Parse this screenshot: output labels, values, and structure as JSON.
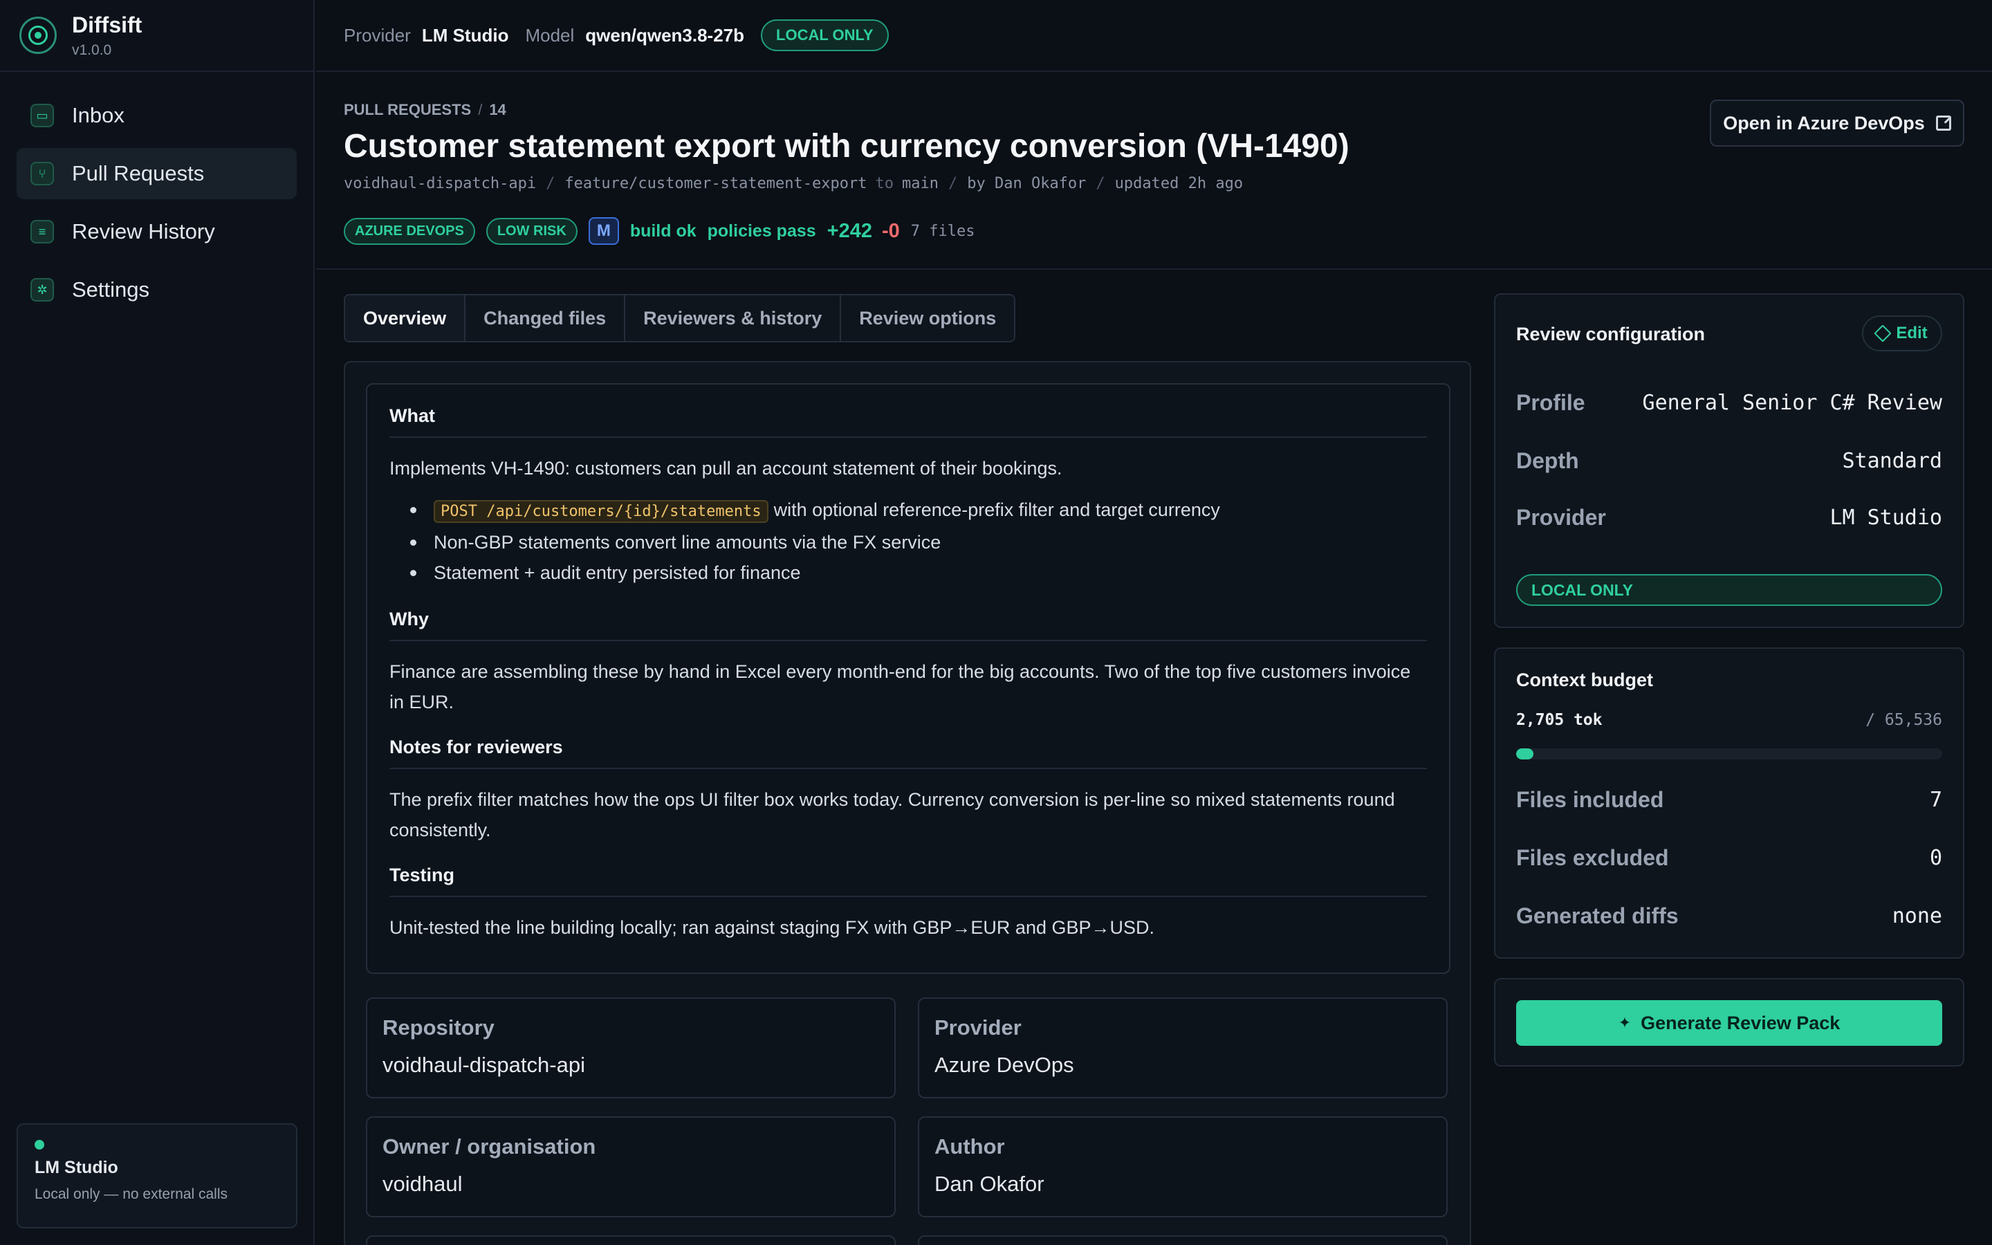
{
  "app": {
    "name": "Diffsift",
    "version": "v1.0.0"
  },
  "sidebar": {
    "items": [
      {
        "label": "Inbox",
        "icon": "inbox-icon"
      },
      {
        "label": "Pull Requests",
        "icon": "git-pull-request-icon",
        "active": true
      },
      {
        "label": "Review History",
        "icon": "history-icon"
      },
      {
        "label": "Settings",
        "icon": "gear-icon"
      }
    ],
    "status": {
      "title": "LM Studio",
      "subtitle": "Local only — no external calls"
    }
  },
  "topbar": {
    "provider_label": "Provider",
    "provider_value": "LM Studio",
    "model_label": "Model",
    "model_value": "qwen/qwen3.8-27b",
    "badge": "LOCAL ONLY"
  },
  "header": {
    "breadcrumb": {
      "section": "PULL REQUESTS",
      "sep": "/",
      "id": "14"
    },
    "title": "Customer statement export with currency conversion (VH-1490)",
    "meta": {
      "repo": "voidhaul-dispatch-api",
      "branch": "feature/customer-statement-export",
      "to_word": "to",
      "target": "main",
      "author": "by Dan Okafor",
      "updated": "updated 2h ago"
    },
    "badges": {
      "source": "AZURE DEVOPS",
      "risk": "LOW RISK",
      "size": "M",
      "build": "build ok",
      "policies": "policies pass",
      "additions": "+242",
      "deletions": "-0",
      "files": "7 files"
    },
    "open_button": "Open in Azure DevOps"
  },
  "tabs": [
    {
      "label": "Overview",
      "active": true
    },
    {
      "label": "Changed files"
    },
    {
      "label": "Reviewers & history"
    },
    {
      "label": "Review options"
    }
  ],
  "description": {
    "what_heading": "What",
    "what_text": "Implements VH-1490: customers can pull an account statement of their bookings.",
    "bullets": {
      "b1_code": "POST /api/customers/{id}/statements",
      "b1_text": "with optional reference-prefix filter and target currency",
      "b2": "Non-GBP statements convert line amounts via the FX service",
      "b3": "Statement + audit entry persisted for finance"
    },
    "why_heading": "Why",
    "why_text": "Finance are assembling these by hand in Excel every month-end for the big accounts. Two of the top five customers invoice in EUR.",
    "notes_heading": "Notes for reviewers",
    "notes_text": "The prefix filter matches how the ops UI filter box works today. Currency conversion is per-line so mixed statements round consistently.",
    "testing_heading": "Testing",
    "testing_text": "Unit-tested the line building locally; ran against staging FX with GBP→EUR and GBP→USD."
  },
  "info": {
    "repository": {
      "label": "Repository",
      "value": "voidhaul-dispatch-api"
    },
    "provider": {
      "label": "Provider",
      "value": "Azure DevOps"
    },
    "owner": {
      "label": "Owner / organisation",
      "value": "voidhaul"
    },
    "author": {
      "label": "Author",
      "value": "Dan Okafor"
    }
  },
  "review_config": {
    "title": "Review configuration",
    "edit_label": "Edit",
    "profile_label": "Profile",
    "profile_value": "General Senior C# Review",
    "depth_label": "Depth",
    "depth_value": "Standard",
    "provider_label": "Provider",
    "provider_value": "LM Studio",
    "badge": "LOCAL ONLY"
  },
  "context_budget": {
    "title": "Context budget",
    "used": "2,705 tok",
    "limit": "/ 65,536",
    "fraction": 0.041,
    "files_included_label": "Files included",
    "files_included_value": "7",
    "files_excluded_label": "Files excluded",
    "files_excluded_value": "0",
    "generated_diffs_label": "Generated diffs",
    "generated_diffs_value": "none"
  },
  "generate_button": "Generate Review Pack",
  "colors": {
    "accent": "#2fcf9e",
    "danger": "#f26b6b",
    "background": "#0b0f16"
  }
}
